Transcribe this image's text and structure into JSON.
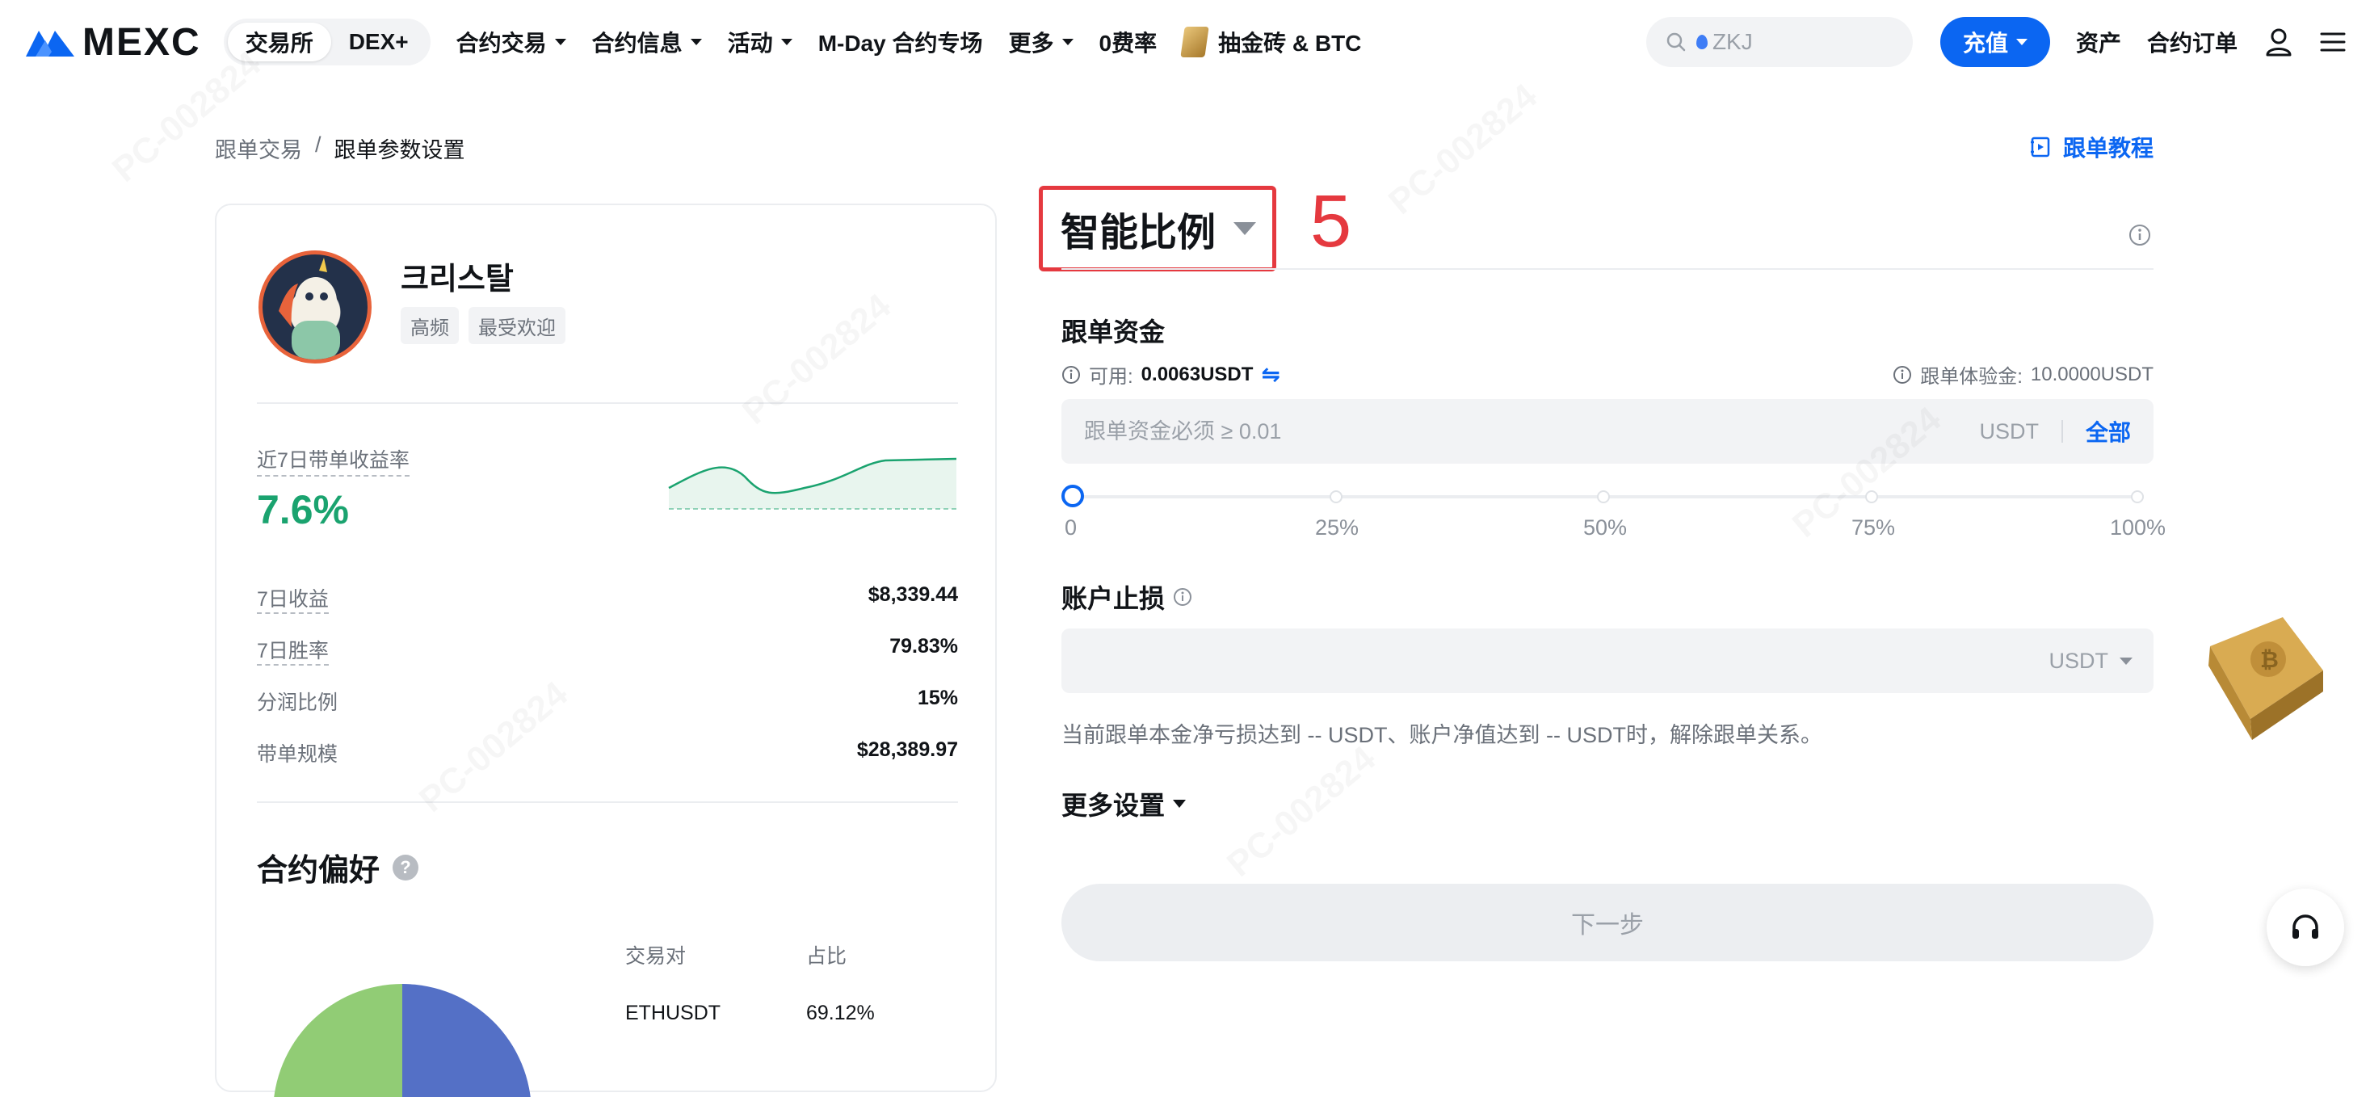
{
  "nav": {
    "logo_text": "MEXC",
    "switch": [
      "交易所",
      "DEX+"
    ],
    "menu": [
      {
        "label": "合约交易",
        "caret": true
      },
      {
        "label": "合约信息",
        "caret": true
      },
      {
        "label": "活动",
        "caret": true
      },
      {
        "label": "M-Day 合约专场",
        "caret": false
      },
      {
        "label": "更多",
        "caret": true
      },
      {
        "label": "0费率",
        "caret": false
      },
      {
        "label": "抽金砖 & BTC",
        "caret": false
      }
    ],
    "search_placeholder": "ZKJ",
    "deposit_label": "充值",
    "assets_label": "资产",
    "orders_label": "合约订单",
    "brand_color": "#0b66f2"
  },
  "breadcrumb": {
    "parent": "跟单交易",
    "separator": "/",
    "current": "跟单参数设置"
  },
  "tutorial_label": "跟单教程",
  "trader": {
    "name": "크리스탈",
    "tags": [
      "高频",
      "最受欢迎"
    ],
    "roi_label": "近7日带单收益率",
    "roi_value": "7.6%",
    "stats": [
      {
        "label": "7日收益",
        "value": "$8,339.44",
        "dashed": true
      },
      {
        "label": "7日胜率",
        "value": "79.83%",
        "dashed": true
      },
      {
        "label": "分润比例",
        "value": "15%",
        "dashed": false
      },
      {
        "label": "带单规模",
        "value": "$28,389.97",
        "dashed": false
      }
    ],
    "preference_title": "合约偏好",
    "pref_columns": [
      "交易对",
      "占比"
    ],
    "pref_rows": [
      {
        "pair": "ETHUSDT",
        "ratio": "69.12%"
      }
    ]
  },
  "form": {
    "mode_label": "智能比例",
    "step_number": "5",
    "fund_title": "跟单资金",
    "available_label": "可用:",
    "available_value": "0.0063USDT",
    "trial_label": "跟单体验金:",
    "trial_value": "10.0000USDT",
    "fund_placeholder": "跟单资金必须 ≥ 0.01",
    "fund_unit": "USDT",
    "all_label": "全部",
    "slider_marks": [
      "0",
      "25%",
      "50%",
      "75%",
      "100%"
    ],
    "slider_value": 0,
    "stoploss_title": "账户止损",
    "stoploss_unit": "USDT",
    "hint": "当前跟单本金净亏损达到 -- USDT、账户净值达到 -- USDT时，解除跟单关系。",
    "more_settings": "更多设置",
    "next_label": "下一步",
    "accent_red": "#e5393f"
  },
  "watermark": "PC-002824"
}
